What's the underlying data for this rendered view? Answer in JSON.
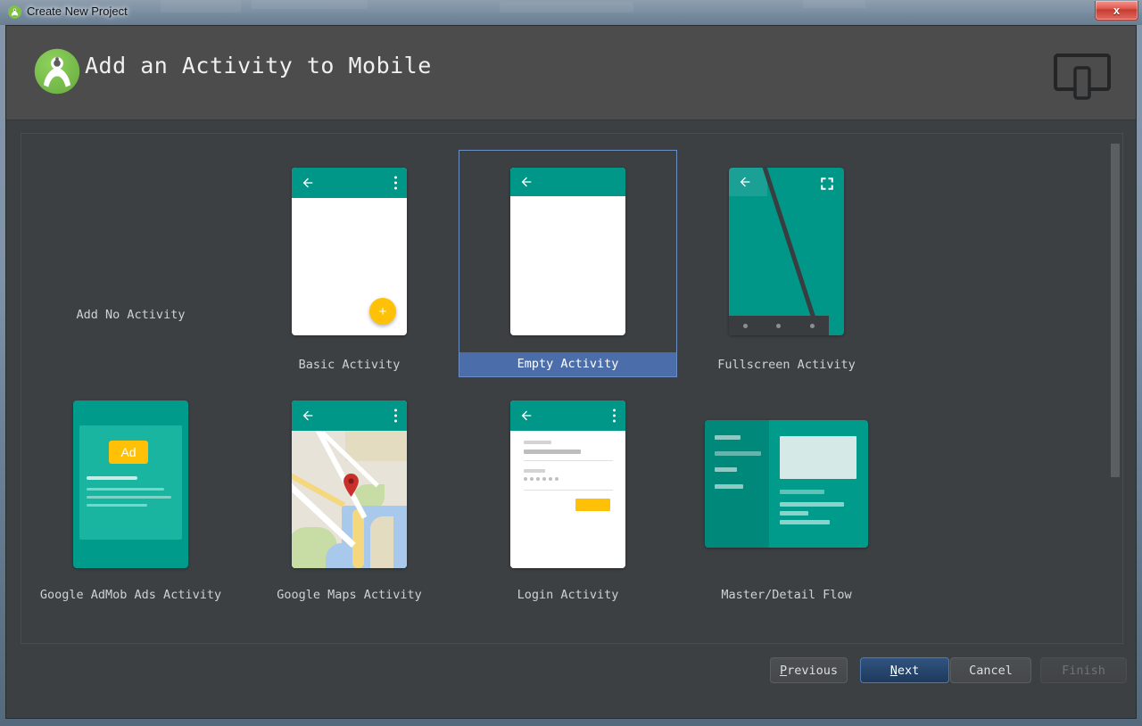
{
  "window": {
    "title": "Create New Project",
    "title_icon": "android-studio-icon",
    "close_label": "x"
  },
  "header": {
    "title": "Add an Activity to Mobile",
    "logo_icon": "android-studio-logo",
    "form_factor_icon": "tablet-phone-icon"
  },
  "templates": [
    {
      "label": "Add No Activity",
      "thumb": "none",
      "selected": false
    },
    {
      "label": "Basic Activity",
      "thumb": "basic",
      "selected": false
    },
    {
      "label": "Empty Activity",
      "thumb": "empty",
      "selected": true
    },
    {
      "label": "Fullscreen Activity",
      "thumb": "fullscreen",
      "selected": false
    },
    {
      "label": "Google AdMob Ads Activity",
      "thumb": "admob",
      "selected": false
    },
    {
      "label": "Google Maps Activity",
      "thumb": "maps",
      "selected": false
    },
    {
      "label": "Login Activity",
      "thumb": "login",
      "selected": false
    },
    {
      "label": "Master/Detail Flow",
      "thumb": "masterdetail",
      "selected": false
    }
  ],
  "thumbnail_text": {
    "ad_badge": "Ad",
    "fab_glyph": "+"
  },
  "buttons": {
    "previous": {
      "label": "Previous",
      "mnemonic": "P",
      "rest": "revious",
      "state": "enabled"
    },
    "next": {
      "label": "Next",
      "mnemonic": "N",
      "rest": "ext",
      "state": "default"
    },
    "cancel": {
      "label": "Cancel",
      "state": "enabled"
    },
    "finish": {
      "label": "Finish",
      "state": "disabled"
    }
  },
  "colors": {
    "dialog_bg": "#3c4043",
    "header_bg": "#4c4c4c",
    "selection_blue": "#4b6eaa",
    "selection_border": "#6b8fc4",
    "material_teal": "#009688",
    "accent_amber": "#ffc107",
    "android_green": "#78c257",
    "next_button_blue": "#2f5380"
  }
}
